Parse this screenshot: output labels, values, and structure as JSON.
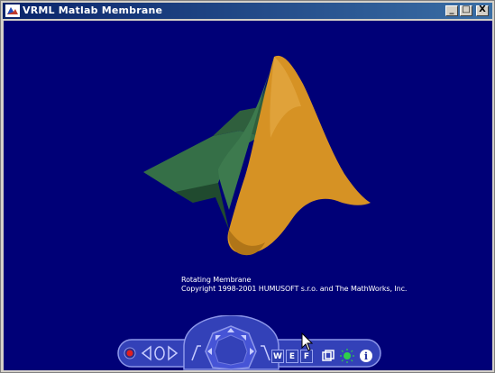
{
  "window": {
    "title": "VRML Matlab Membrane",
    "controls": {
      "minimize": "_",
      "maximize": "□",
      "close": "X"
    }
  },
  "scene": {
    "background_color": "#000077",
    "surface_colors": {
      "front": "#d69224",
      "side": "#356f47"
    },
    "caption_line1": "Rotating Membrane",
    "caption_line2": "Copyright 1998-2001 HUMUSOFT s.r.o. and The MathWorks, Inc."
  },
  "navigation_bar": {
    "buttons": {
      "walk": "W",
      "examine": "E",
      "fly": "F"
    },
    "icons": [
      "record-icon",
      "rewind-icon",
      "play-icon",
      "forward-icon",
      "direction-pad-icon",
      "views-icon",
      "headlight-icon",
      "info-icon"
    ]
  }
}
